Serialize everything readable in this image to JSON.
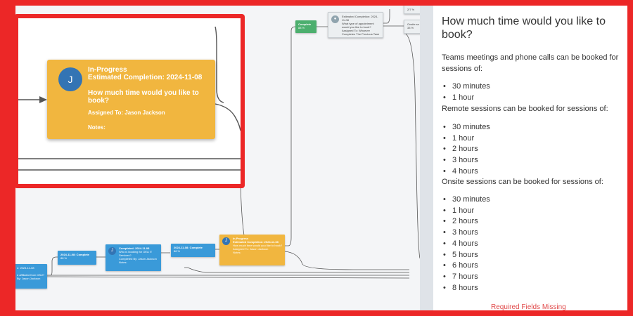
{
  "workflow": {
    "avatar_initial": "J",
    "focused_step": {
      "status": "In-Progress",
      "estimated": "Estimated Completion: 2024-11-08",
      "question": "How much time would you like to book?",
      "assigned": "Assigned To: Jason Jackson",
      "notes": "Notes:"
    },
    "mini_nodes": {
      "left_edge": {
        "line1": "e: 2024-11-08",
        "line2": "d affiliated from CBU?",
        "line3": "By: Jason Jackson"
      },
      "step_complete_1": {
        "line1": "2024-11-08: Complete",
        "line2": "88 %"
      },
      "step_complete_2": {
        "line1": "Completed: 2024-11-08",
        "line2": "Who is booking for OEA IT Services?",
        "line3": "Completed By: Jason Jackson",
        "line4": "Notes:"
      },
      "step_complete_3": {
        "line1": "2024-11-08: Complete",
        "line2": "88 %"
      },
      "step_in_progress": {
        "line1": "In-Progress",
        "line2": "Estimated Completion: 2024-11-08",
        "line3": "How much time would you like to book?",
        "line4": "Assigned To: Jason Jackson",
        "line5": "Notes:"
      },
      "complete_green": {
        "line1": "Complete",
        "line2": "88 %"
      },
      "appointment": {
        "line1": "Estimated Completion: 2024-11-08",
        "line2": "What type of appointment would you like to book?",
        "line3": "Assigned To: Whoever Completes The Previous Task"
      },
      "top_small": {
        "line1": "2/7 %"
      },
      "onsite": {
        "line1": "Onsite se",
        "line2": "33 %"
      }
    }
  },
  "panel": {
    "title": "How much time would you like to book?",
    "teams_intro": "Teams meetings and phone calls can be booked for sessions of:",
    "teams_options": [
      "30 minutes",
      "1 hour"
    ],
    "remote_intro": "Remote sessions can be booked for sessions of:",
    "remote_options": [
      "30 minutes",
      "1 hour",
      "2 hours",
      "3 hours",
      "4 hours"
    ],
    "onsite_intro": "Onsite sessions can be booked for sessions of:",
    "onsite_options": [
      "30 minutes",
      "1 hour",
      "2 hours",
      "3 hours",
      "4 hours",
      "5 hours",
      "6 hours",
      "7 hours",
      "8 hours"
    ],
    "required_missing": "Required Fields Missing"
  },
  "colors": {
    "highlight": "#ec2727",
    "in_progress": "#f1b63f",
    "complete": "#3a9ad9",
    "complete_green": "#4caf6e",
    "avatar": "#3374b4",
    "error": "#e14b4b"
  }
}
